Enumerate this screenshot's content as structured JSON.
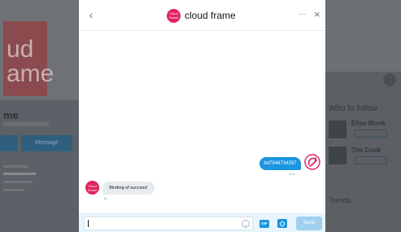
{
  "background": {
    "banner_text": "ud\name",
    "profile_name": "me",
    "message_button_label": "Message",
    "who_to_follow": "Who to follow",
    "suggest_1": "Elise Monk",
    "suggest_2": "Tim Cook",
    "follow_label": "Follow",
    "trends": "Trends"
  },
  "modal": {
    "title": "cloud frame",
    "back_glyph": "‹",
    "more_glyph": "···",
    "close_glyph": "×",
    "avatar_text": "Cloud Frame"
  },
  "messages": [
    {
      "direction": "sent",
      "text": "bd7946734257",
      "time": "now"
    },
    {
      "direction": "received",
      "text": "Binding of success!",
      "time": "6s"
    }
  ],
  "composer": {
    "input_value": "",
    "gif_label": "GIF",
    "send_label": "Send"
  },
  "colors": {
    "accent": "#1b95e0",
    "brand": "#e0245e",
    "send_disabled": "#9fd0f0"
  }
}
